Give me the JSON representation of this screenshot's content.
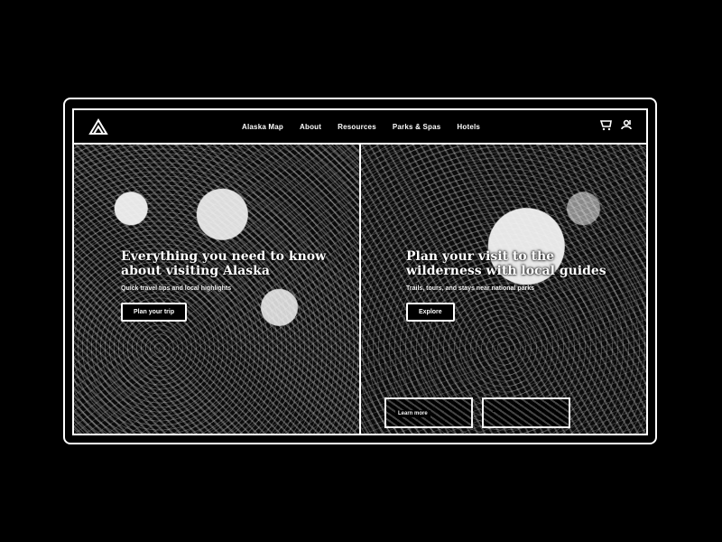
{
  "window": {
    "title": ""
  },
  "nav": {
    "items": [
      "Alaska Map",
      "About",
      "Resources",
      "Parks & Spas",
      "Hotels"
    ]
  },
  "icons": {
    "logo": "mountain-logo-icon",
    "cart": "cart-icon",
    "profile": "profile-icon"
  },
  "panels": [
    {
      "headline": "Everything you need to know about visiting Alaska",
      "subhead": "Quick travel tips and local highlights",
      "cta": "Plan your trip"
    },
    {
      "headline": "Plan your visit to the wilderness with local guides",
      "subhead": "Trails, tours, and stays near national parks",
      "cta": "Explore",
      "tiles": [
        {
          "label": "Learn more"
        },
        {
          "label": ""
        }
      ]
    }
  ]
}
